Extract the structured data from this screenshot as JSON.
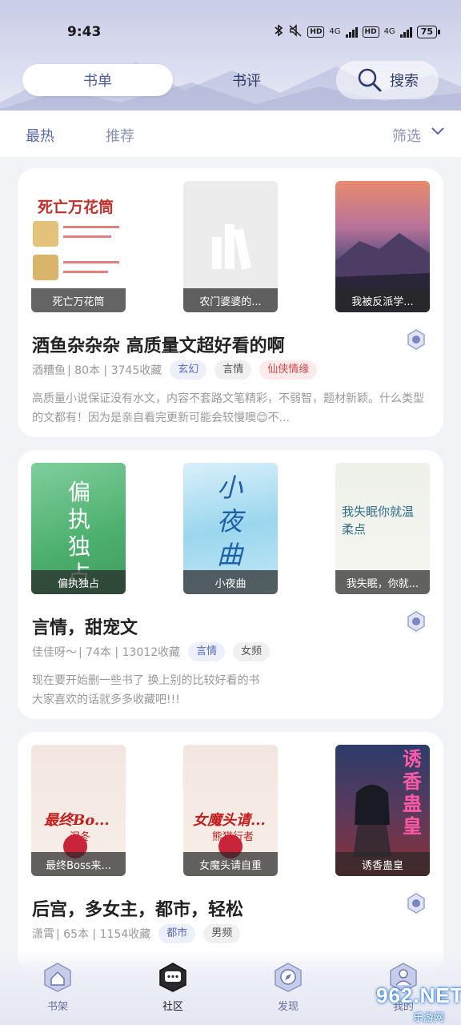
{
  "status_bar": {
    "time": "9:43",
    "net1": "4G",
    "net2": "4G",
    "hd1": "HD",
    "hd2": "HD",
    "battery": "75"
  },
  "header": {
    "tabs": [
      {
        "label": "书单"
      },
      {
        "label": "书评"
      }
    ],
    "search_label": "搜索"
  },
  "filter_bar": {
    "hot": "最热",
    "recommend": "推荐",
    "filter": "筛选"
  },
  "cards": [
    {
      "covers": [
        {
          "caption": "死亡万花筒",
          "art_title": "死亡万花筒"
        },
        {
          "caption": "农门婆婆的..."
        },
        {
          "caption": "我被反派学..."
        }
      ],
      "title": "酒鱼杂杂杂 高质量文超好看的啊",
      "author": "酒糟鱼",
      "stats": "| 80本 | 3745收藏",
      "tags": [
        "玄幻",
        "言情",
        "仙侠情缘"
      ],
      "desc": "高质量小说保证没有水文，内容不套路文笔精彩，不弱智，题材新颖。什么类型的文都有！因为是亲自看完更新可能会较慢噢😊不..."
    },
    {
      "covers": [
        {
          "caption": "偏执独占",
          "art_title": "偏执独占"
        },
        {
          "caption": "小夜曲",
          "art_title": "小夜曲"
        },
        {
          "caption": "我失眠，你就...",
          "art_title": "我失眠你就温柔点"
        }
      ],
      "title": "言情，甜宠文",
      "author": "佳佳呀～",
      "stats": "| 74本 | 13012收藏",
      "tags": [
        "言情",
        "女频"
      ],
      "desc": "现在要开始删一些书了 换上别的比较好看的书\n大家喜欢的话就多多收藏吧!!!"
    },
    {
      "covers": [
        {
          "caption": "最终Boss来...",
          "art_title": "最终Bo...",
          "art_author": "泯冬"
        },
        {
          "caption": "女魔头请自重",
          "art_title": "女魔头请...",
          "art_author": "熊猫行者"
        },
        {
          "caption": "诱香蛊皇",
          "art_title": "诱香蛊皇"
        }
      ],
      "title": "后宫，多女主，都市，轻松",
      "author": "潇霄",
      "stats": "| 65本 | 1154收藏",
      "tags": [
        "都市",
        "男频"
      ],
      "desc": ""
    }
  ],
  "bottom_nav": [
    {
      "label": "书架",
      "icon": "home-icon"
    },
    {
      "label": "社区",
      "icon": "chat-icon"
    },
    {
      "label": "发现",
      "icon": "compass-icon"
    },
    {
      "label": "我的",
      "icon": "user-icon"
    }
  ],
  "watermark": {
    "big": "962.NET",
    "small": "乐游网"
  },
  "colors": {
    "accent": "#5a6aa8",
    "tag_blue": "#5b6cc0",
    "tag_red": "#d04a4a"
  }
}
